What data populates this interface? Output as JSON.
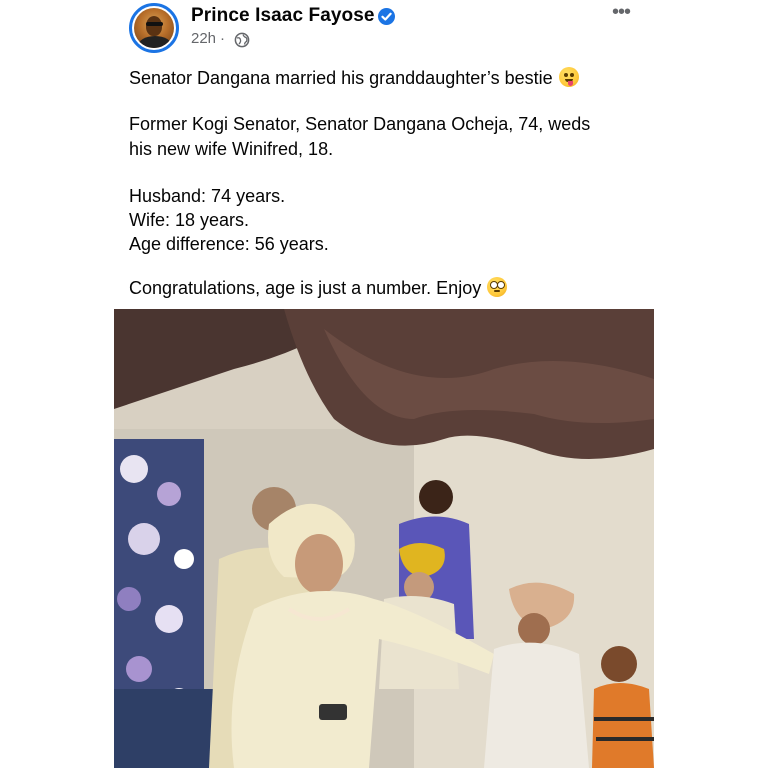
{
  "post": {
    "author": "Prince Isaac Fayose",
    "time": "22h",
    "separator": "·",
    "audience_icon": "globe-icon",
    "verified_icon": "verified-badge-icon",
    "more_icon": "more-options-icon",
    "more_label": "•••",
    "lines": {
      "p1": "Senator Dangana married his granddaughter’s bestie",
      "p2a": "Former Kogi Senator, Senator Dangana Ocheja, 74, weds",
      "p2b": "his new wife Winifred, 18.",
      "p3a": "Husband: 74 years.",
      "p3b": "Wife: 18 years.",
      "p3c": "Age difference: 56 years.",
      "p4": "Congratulations, age is just a number. Enjoy"
    },
    "emojis": [
      "zany-face-emoji",
      "face-with-rolling-eyes-emoji"
    ]
  },
  "colors": {
    "accent": "#1b74e4",
    "secondary_text": "#65676b",
    "primary_text": "#050505"
  }
}
